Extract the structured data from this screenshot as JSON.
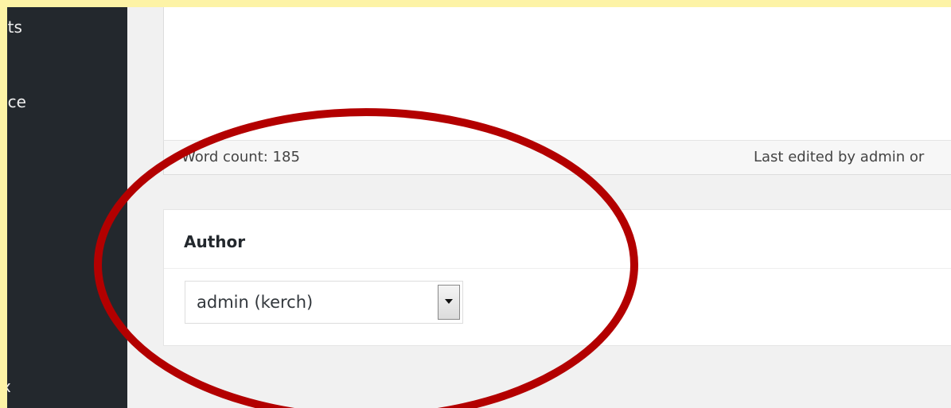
{
  "sidebar": {
    "items": [
      {
        "label": "nts"
      },
      {
        "label": "nce"
      },
      {
        "label": "x"
      }
    ]
  },
  "editor": {
    "word_count": "Word count: 185",
    "last_edited": "Last edited by admin or"
  },
  "author_box": {
    "title": "Author",
    "selected_value": "admin (kerch)"
  },
  "colors": {
    "background": "#fdf3a6",
    "sidebar": "#23282d",
    "highlight": "#b30000"
  }
}
